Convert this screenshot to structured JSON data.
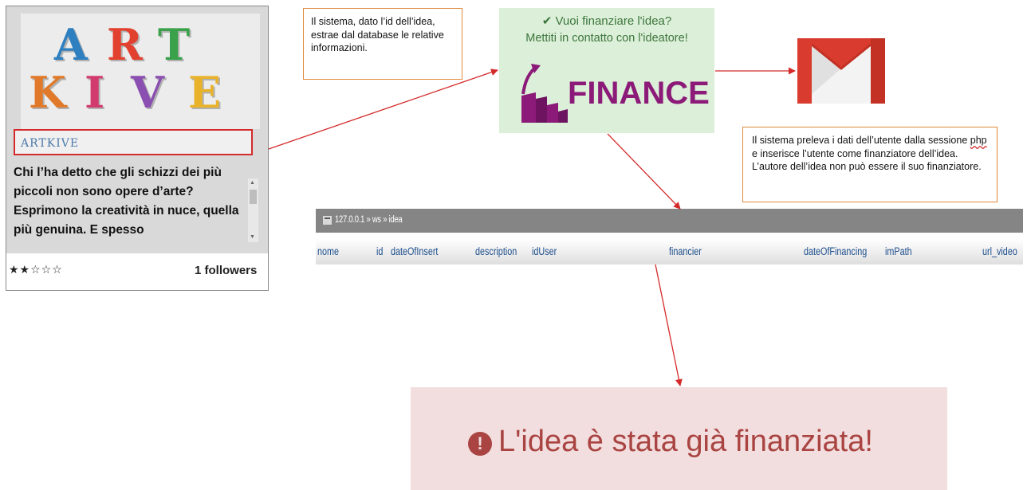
{
  "card": {
    "logo": [
      "A",
      "R",
      "T",
      "K",
      "I",
      "V",
      "E"
    ],
    "title": "ARTKIVE",
    "description": "Chi l’ha detto che gli schizzi dei più piccoli non sono opere d’arte? Esprimono la creatività in nuce, quella più genuina. E spesso",
    "stars": "★★☆☆☆",
    "followers": "1 followers"
  },
  "note_query": "Il sistema, dato l’id dell’idea, estrae dal database le relative informazioni.",
  "note_session": {
    "before": "Il sistema preleva i dati dell’utente dalla sessione ",
    "misspelled": "php",
    "after": " e inserisce l’utente come finanziatore dell’idea. L’autore dell’idea non può essere il suo finanziatore."
  },
  "finance_panel": {
    "line1": "✔ Vuoi finanziare l'idea?",
    "line2": "Mettiti in contatto con l'ideatore!",
    "logo_word": "FINANCE"
  },
  "db_table": {
    "breadcrumb": "127.0.0.1 » ws » idea",
    "columns": [
      "nome",
      "id",
      "dateOfInsert",
      "description",
      "idUser",
      "financier",
      "dateOfFinancing",
      "imPath",
      "url_video"
    ]
  },
  "alert": {
    "icon": "!",
    "message": "L'idea è stata già finanziata!"
  },
  "colors": {
    "arrow": "#d42a2a",
    "note_border": "#e08a3c",
    "finance_bg": "#dcefd8",
    "finance_text": "#3c763d",
    "finance_logo": "#8b1a78",
    "alert_bg": "#f2dede",
    "alert_text": "#a94442",
    "db_bar": "#858585",
    "db_header_text": "#1e4f8c"
  },
  "icons": [
    "checkmark-icon",
    "finance-chart-icon",
    "gmail-icon",
    "server-icon",
    "database-icon",
    "table-icon",
    "exclamation-circle-icon",
    "scroll-up-icon",
    "scroll-down-icon"
  ]
}
